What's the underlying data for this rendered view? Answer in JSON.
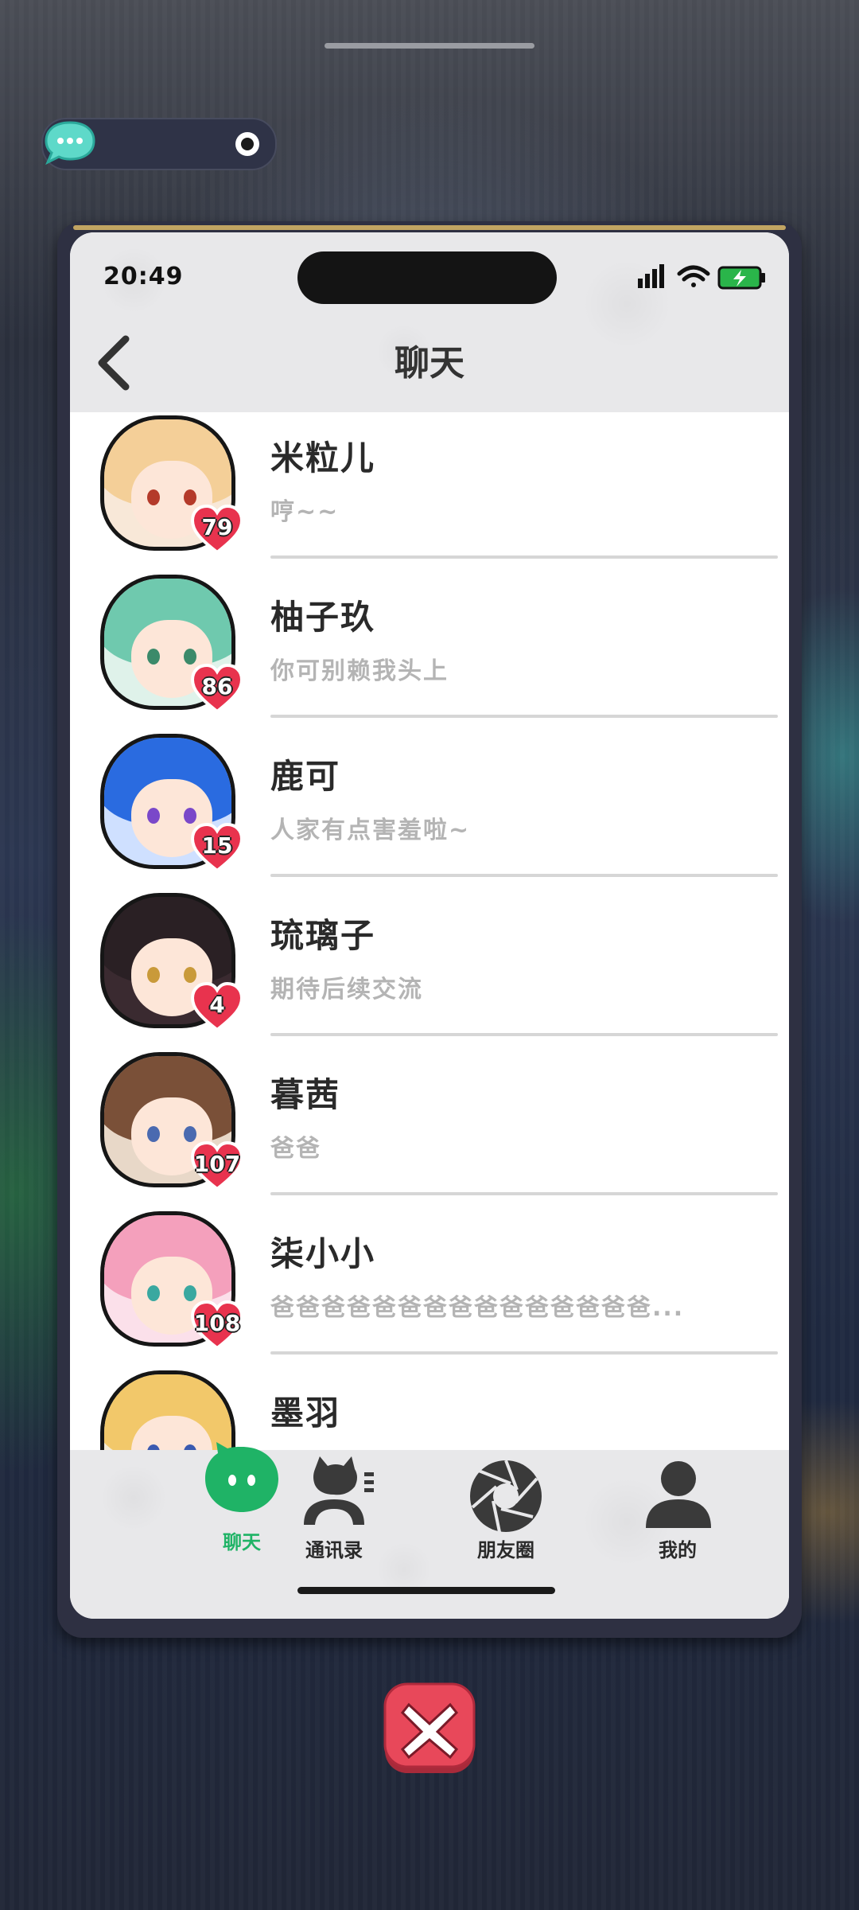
{
  "status_bar": {
    "time": "20:49"
  },
  "header": {
    "title": "聊天"
  },
  "chats": [
    {
      "name": "米粒儿",
      "message": "哼~~",
      "affection": "79",
      "hair": "#f4cf98",
      "eye": "#b43a2a",
      "bg": "#f8e8d8"
    },
    {
      "name": "柚子玖",
      "message": "你可别赖我头上",
      "affection": "86",
      "hair": "#6fc9ae",
      "eye": "#3b8a6a",
      "bg": "#dff2ea"
    },
    {
      "name": "鹿可",
      "message": "人家有点害羞啦~",
      "affection": "15",
      "hair": "#2a6be0",
      "eye": "#7a48c9",
      "bg": "#cfe0ff"
    },
    {
      "name": "琉璃子",
      "message": "期待后续交流",
      "affection": "4",
      "hair": "#2a2024",
      "eye": "#c99a3a",
      "bg": "#3a2a30"
    },
    {
      "name": "暮茜",
      "message": "爸爸",
      "affection": "107",
      "hair": "#7a5038",
      "eye": "#4a6ab0",
      "bg": "#e8d8c8"
    },
    {
      "name": "柒小小",
      "message": "爸爸爸爸爸爸爸爸爸爸爸爸爸爸爸...",
      "affection": "108",
      "hair": "#f4a0bc",
      "eye": "#3aa8a0",
      "bg": "#fbe0ea"
    },
    {
      "name": "墨羽",
      "message": "",
      "affection": "",
      "hair": "#f2c86a",
      "eye": "#3a5ab0",
      "bg": "#f5ecd6"
    }
  ],
  "tabs": [
    {
      "label": "聊天",
      "icon": "chat-bubble-icon",
      "active": true
    },
    {
      "label": "通讯录",
      "icon": "contacts-icon",
      "active": false
    },
    {
      "label": "朋友圈",
      "icon": "shutter-icon",
      "active": false
    },
    {
      "label": "我的",
      "icon": "profile-icon",
      "active": false
    }
  ],
  "colors": {
    "active_tab": "#1fb366",
    "heart": "#e8334e",
    "close_button": "#e8485a"
  }
}
